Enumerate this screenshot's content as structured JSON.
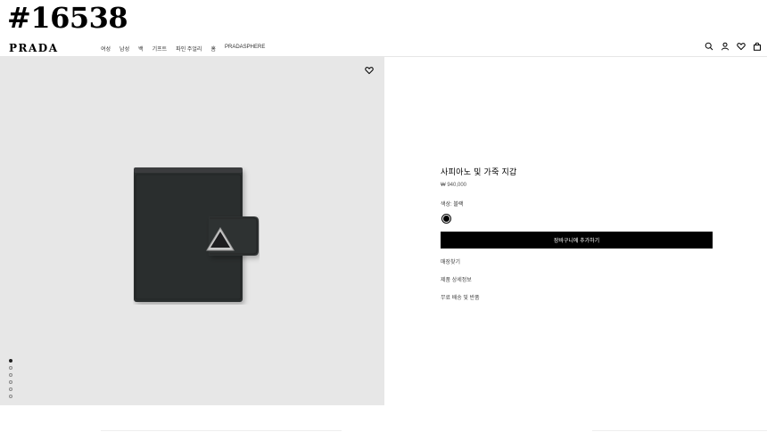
{
  "overlay": {
    "id_text": "#16538"
  },
  "header": {
    "logo": "PRADA",
    "nav": [
      "여성",
      "남성",
      "백",
      "기프트",
      "파인 주얼리",
      "홈",
      "PRADASPHERE"
    ],
    "icons": [
      "search-icon",
      "account-icon",
      "wishlist-icon",
      "bag-icon"
    ]
  },
  "gallery": {
    "dot_count": 6,
    "active_dot": 1,
    "background": "#e7e7e7"
  },
  "product": {
    "name": "사피아노 및 가죽 지갑",
    "price": "₩ 940,000",
    "color_label": "색상: 블랙",
    "add_to_cart": "장바구니에 추가하기",
    "links": [
      "매장찾기",
      "제품 상세정보",
      "무료 배송 및 반품"
    ]
  },
  "colors": {
    "accent": "#000000",
    "image_bg": "#e7e7e7"
  }
}
